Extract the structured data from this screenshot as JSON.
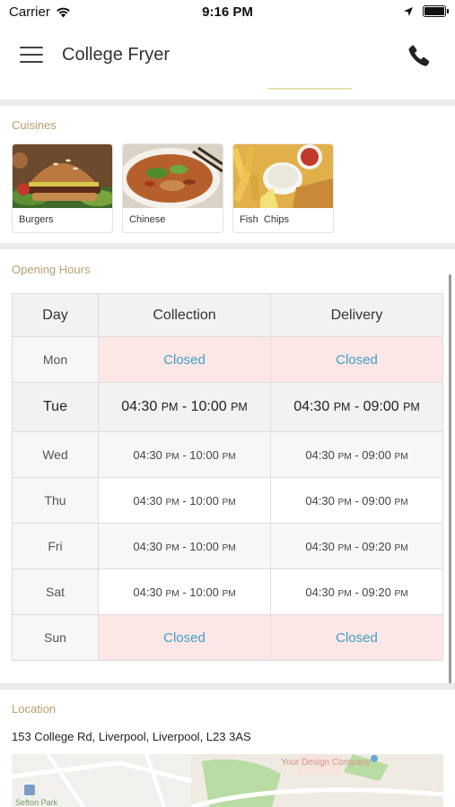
{
  "status_bar": {
    "carrier": "Carrier",
    "time": "9:16 PM"
  },
  "header": {
    "title": "College Fryer"
  },
  "cuisines": {
    "title": "Cuisines",
    "items": [
      {
        "label": "Burgers"
      },
      {
        "label": "Chinese"
      },
      {
        "label": "Fish  Chips"
      }
    ]
  },
  "opening_hours": {
    "title": "Opening Hours",
    "headers": {
      "day": "Day",
      "collection": "Collection",
      "delivery": "Delivery"
    },
    "rows": [
      {
        "day": "Mon",
        "collection": {
          "closed": "Closed"
        },
        "delivery": {
          "closed": "Closed"
        }
      },
      {
        "day": "Tue",
        "collection": {
          "start": "04:30",
          "start_suffix": "PM",
          "end": "10:00",
          "end_suffix": "PM"
        },
        "delivery": {
          "start": "04:30",
          "start_suffix": "PM",
          "end": "09:00",
          "end_suffix": "PM"
        }
      },
      {
        "day": "Wed",
        "collection": {
          "start": "04:30",
          "start_suffix": "PM",
          "end": "10:00",
          "end_suffix": "PM"
        },
        "delivery": {
          "start": "04:30",
          "start_suffix": "PM",
          "end": "09:00",
          "end_suffix": "PM"
        }
      },
      {
        "day": "Thu",
        "collection": {
          "start": "04:30",
          "start_suffix": "PM",
          "end": "10:00",
          "end_suffix": "PM"
        },
        "delivery": {
          "start": "04:30",
          "start_suffix": "PM",
          "end": "09:00",
          "end_suffix": "PM"
        }
      },
      {
        "day": "Fri",
        "collection": {
          "start": "04:30",
          "start_suffix": "PM",
          "end": "10:00",
          "end_suffix": "PM"
        },
        "delivery": {
          "start": "04:30",
          "start_suffix": "PM",
          "end": "09:20",
          "end_suffix": "PM"
        }
      },
      {
        "day": "Sat",
        "collection": {
          "start": "04:30",
          "start_suffix": "PM",
          "end": "10:00",
          "end_suffix": "PM"
        },
        "delivery": {
          "start": "04:30",
          "start_suffix": "PM",
          "end": "09:20",
          "end_suffix": "PM"
        }
      },
      {
        "day": "Sun",
        "collection": {
          "closed": "Closed"
        },
        "delivery": {
          "closed": "Closed"
        }
      }
    ]
  },
  "location": {
    "title": "Location",
    "address": "153 College Rd, Liverpool, Liverpool, L23 3AS",
    "map_labels": {
      "place": "Your Design Company",
      "area": "Sefton Park"
    }
  },
  "colors": {
    "closed_bg": "#fce6e6",
    "closed_text": "#3fa0c4",
    "section_title": "#b8a070"
  }
}
